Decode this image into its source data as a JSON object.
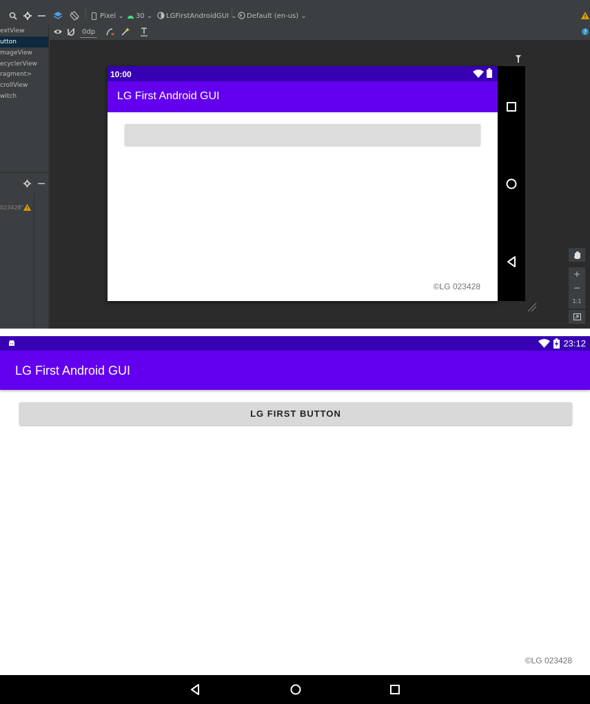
{
  "studio": {
    "toolbar": {
      "device": "Pixel",
      "api": "30",
      "theme": "LGFirstAndroidGUI",
      "locale": "Default (en-us)",
      "margin": "0dp"
    },
    "palette": {
      "items": [
        {
          "label": "extView"
        },
        {
          "label": "utton",
          "selected": true
        },
        {
          "label": "mageView"
        },
        {
          "label": "ecyclerView"
        },
        {
          "label": "ragment>"
        },
        {
          "label": "crollView"
        },
        {
          "label": "witch"
        }
      ]
    },
    "tree": {
      "node_label": "023428\""
    },
    "preview": {
      "status_time": "10:00",
      "app_title": "LG First Android GUI",
      "copyright": "©LG 023428"
    },
    "zoom": {
      "reset_label": "1:1"
    },
    "colors": {
      "background": "#3c3f41",
      "canvas": "#2b2b2b",
      "warning": "#e0a300",
      "selection": "#0d293e"
    }
  },
  "device": {
    "status_time": "23:12",
    "app_title": "LG First Android GUI",
    "button_label": "LG FIRST BUTTON",
    "copyright": "©LG 023428",
    "colors": {
      "primary": "#6200ee",
      "primary_dark": "#3700b3",
      "button": "#d9d9d9"
    }
  }
}
